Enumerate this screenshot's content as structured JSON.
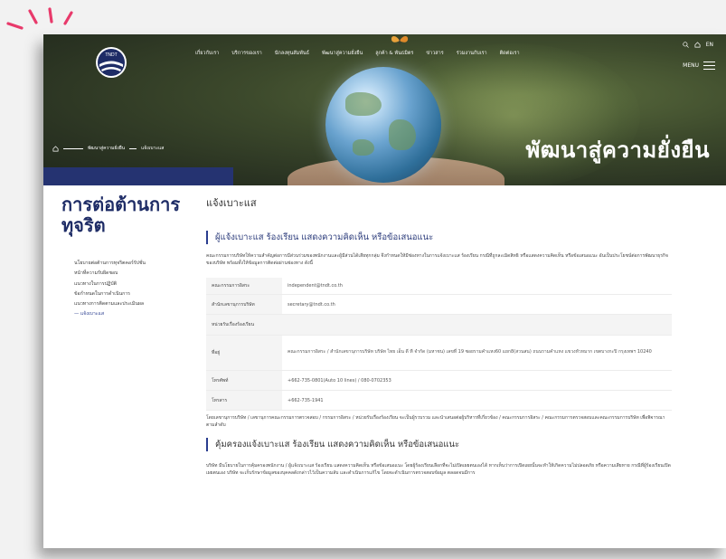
{
  "brand": {
    "logo_text": "TNDT"
  },
  "nav": {
    "items": [
      "เกี่ยวกับเรา",
      "บริการของเรา",
      "นักลงทุนสัมพันธ์",
      "พัฒนาสู่ความยั่งยืน",
      "ลูกค้า & พันธมิตร",
      "ข่าวสาร",
      "ร่วมงานกับเรา",
      "ติดต่อเรา"
    ],
    "lang": "EN",
    "menu_label": "MENU"
  },
  "hero": {
    "title": "พัฒนาสู่ความยั่งยืน",
    "breadcrumb": [
      "พัฒนาสู่ความยั่งยืน",
      "แจ้งเบาะแส"
    ]
  },
  "sidebar": {
    "title": "การต่อต้านการทุจริต",
    "items": [
      "นโยบายต่อต้านการทุจริตคอร์รัปชั่น",
      "หน้าที่ความรับผิดชอบ",
      "แนวทางในการปฏิบัติ",
      "ข้อกำหนดในการดำเนินการ",
      "แนวทางการติดตามและประเมินผล",
      "แจ้งเบาะแส"
    ]
  },
  "main": {
    "heading": "แจ้งเบาะแส",
    "section1": "ผู้แจ้งเบาะแส ร้องเรียน แสดงความคิดเห็น หรือข้อเสนอแนะ",
    "intro": "คณะกรรมการบริษัทให้ความสำคัญต่อการมีส่วนร่วมของพนักงานและผู้มีส่วนได้เสียทุกกลุ่ม จึงกำหนดให้มีช่องทางในการแจ้งเบาะแส ร้องเรียน กรณีที่ถูกละเมิดสิทธิ หรือแสดงความคิดเห็น หรือข้อเสนอแนะ อันเป็นประโยชน์ต่อการพัฒนาธุรกิจของบริษัท พร้อมทั้งให้ข้อมูลการติดต่อผ่านช่องทาง ดังนี้",
    "table": [
      {
        "label": "คณะกรรมการอิสระ",
        "value": "independent@tndt.co.th"
      },
      {
        "label": "สำนักเลขานุการบริษัท",
        "value": "secretary@tndt.co.th"
      },
      {
        "label": "หน่วยรับเรื่องร้องเรียน",
        "value": ""
      },
      {
        "label": "ที่อยู่",
        "value": "คณะกรรมการอิสระ / สำนักเลขานุการบริษัท บริษัท ไทย เอ็น ดี ที จำกัด (มหาชน) เลขที่ 19 ซอยรามคำแหง60 แยก8(สวนสน) ถนนรามคำแหง แขวงหัวหมาก เขตบางกะปิ กรุงเทพฯ 10240"
      },
      {
        "label": "โทรศัพท์",
        "value": "+662-735-0801(Auto 10 lines) / 080-0702353"
      },
      {
        "label": "โทรสาร",
        "value": "+662-735-1941"
      }
    ],
    "note": "โดยเลขานุการบริษัท / เลขานุการคณะกรรมการตรวจสอบ / กรรมการอิสระ / หน่วยรับเรื่องร้องเรียน จะเป็นผู้รวบรวม และนำเสนอต่อผู้บริหารที่เกี่ยวข้อง / คณะกรรมการอิสระ / คณะกรรมการตรวจสอบและคณะกรรมการบริษัท เพื่อพิจารณาตามลำดับ",
    "section2": "คุ้มครองแจ้งเบาะแส ร้องเรียน แสดงความคิดเห็น หรือข้อเสนอแนะ",
    "para2": "บริษัท มีนโยบายในการคุ้มครองพนักงาน / ผู้แจ้งเบาะแส ร้องเรียน แสดงความคิดเห็น หรือข้อเสนอแนะ โดยผู้ร้องเรียนเลือกที่จะไม่เปิดเผยตนเองได้ หากเห็นว่าการเปิดเผยนั้นจะทำให้เกิดความไม่ปลอดภัย หรือความเสียหาย กรณีที่ผู้ร้องเรียนเปิดเผยตนเอง บริษัท จะเก็บรักษาข้อมูลของบุคคลดังกล่าวไว้เป็นความลับ และดำเนินการแก้ไข โดยจะดำเนินการตรวจสอบข้อมูล ตลอดจนมีการ"
  }
}
